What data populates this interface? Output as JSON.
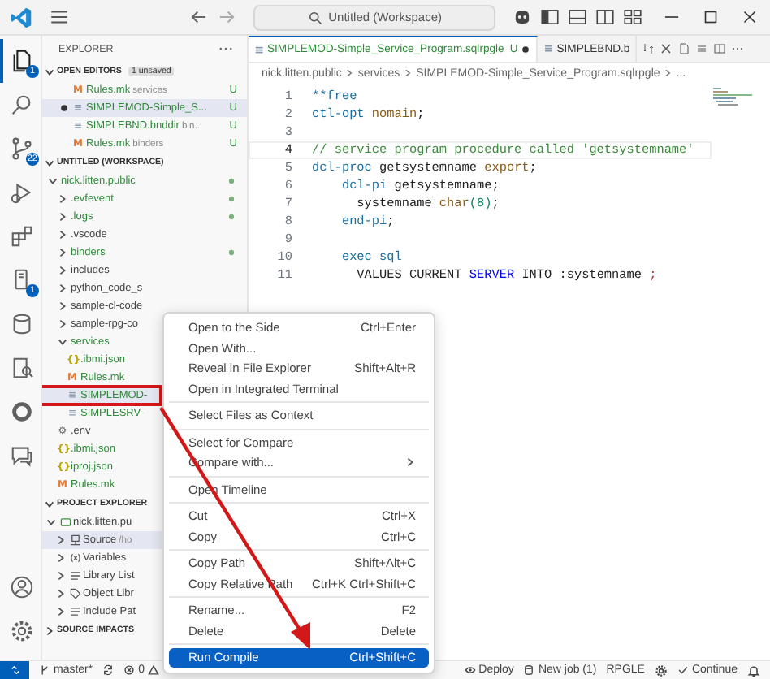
{
  "title_bar": {
    "search": "Untitled (Workspace)"
  },
  "activity_bar": {
    "items": [
      {
        "kind": "files",
        "badge": "1",
        "selected": true
      },
      {
        "kind": "search",
        "selected": false
      },
      {
        "kind": "source-control",
        "badge": "22",
        "selected": false
      },
      {
        "kind": "run",
        "selected": false
      },
      {
        "kind": "extensions",
        "selected": false
      },
      {
        "kind": "device",
        "badge": "1",
        "selected": false
      },
      {
        "kind": "database",
        "selected": false
      },
      {
        "kind": "search-doc",
        "selected": false
      },
      {
        "kind": "ring",
        "selected": false
      },
      {
        "kind": "chat",
        "selected": false
      }
    ],
    "bottom": [
      {
        "kind": "account"
      },
      {
        "kind": "settings"
      }
    ]
  },
  "sidebar": {
    "title": "EXPLORER",
    "open_editors": {
      "title": "OPEN EDITORS",
      "badge": "1 unsaved",
      "expanded": true,
      "items": [
        {
          "glyph": "M",
          "kind": "make",
          "name": "Rules.mk",
          "description": "services",
          "status": "U",
          "dirty": false,
          "selected": false
        },
        {
          "glyph": "≡",
          "kind": "source",
          "name": "SIMPLEMOD-Simple_S...",
          "status": "U",
          "dirty": true,
          "selected": true
        },
        {
          "glyph": "≡",
          "kind": "source",
          "name": "SIMPLEBND.bnddir",
          "description": "bin...",
          "status": "U",
          "dirty": false,
          "selected": false
        },
        {
          "glyph": "M",
          "kind": "make",
          "name": "Rules.mk",
          "description": "binders",
          "status": "U",
          "dirty": false,
          "selected": false
        }
      ]
    },
    "workspace": {
      "title": "UNTITLED (WORKSPACE)",
      "expanded": true,
      "items": [
        {
          "name": "nick.litten.public",
          "kind": "folder",
          "expanded": true,
          "untracked": true,
          "dot": true,
          "selected": false,
          "boxed": false,
          "children": [
            {
              "name": ".evfevent",
              "kind": "folder",
              "expanded": false,
              "untracked": true,
              "dot": true,
              "selected": false,
              "boxed": false
            },
            {
              "name": ".logs",
              "kind": "folder",
              "expanded": false,
              "untracked": true,
              "dot": true,
              "selected": false,
              "boxed": false
            },
            {
              "name": ".vscode",
              "kind": "folder",
              "expanded": false,
              "untracked": false,
              "dot": false,
              "selected": false,
              "boxed": false
            },
            {
              "name": "binders",
              "kind": "folder",
              "expanded": false,
              "untracked": true,
              "dot": true,
              "selected": false,
              "boxed": false
            },
            {
              "name": "includes",
              "kind": "folder",
              "expanded": false,
              "untracked": false,
              "dot": false,
              "selected": false,
              "boxed": false
            },
            {
              "name": "python_code_s",
              "kind": "folder",
              "expanded": false,
              "untracked": false,
              "dot": false,
              "selected": false,
              "boxed": false
            },
            {
              "name": "sample-cl-code",
              "kind": "folder",
              "expanded": false,
              "untracked": false,
              "dot": false,
              "selected": false,
              "boxed": false
            },
            {
              "name": "sample-rpg-co",
              "kind": "folder",
              "expanded": false,
              "untracked": false,
              "dot": false,
              "selected": false,
              "boxed": false
            },
            {
              "name": "services",
              "kind": "folder",
              "expanded": true,
              "untracked": true,
              "dot": false,
              "selected": false,
              "boxed": false,
              "children": [
                {
                  "name": ".ibmi.json",
                  "kind": "json",
                  "glyph": "{}",
                  "untracked": true,
                  "dot": false,
                  "selected": false,
                  "boxed": false
                },
                {
                  "name": "Rules.mk",
                  "kind": "make",
                  "glyph": "M",
                  "untracked": true,
                  "dot": false,
                  "selected": false,
                  "boxed": false
                },
                {
                  "name": "SIMPLEMOD-",
                  "kind": "source",
                  "glyph": "≡",
                  "untracked": true,
                  "dot": false,
                  "selected": true,
                  "boxed": true
                },
                {
                  "name": "SIMPLESRV-",
                  "kind": "source",
                  "glyph": "≡",
                  "untracked": true,
                  "dot": false,
                  "selected": false,
                  "boxed": false
                }
              ]
            },
            {
              "name": ".env",
              "kind": "env",
              "glyph": "⚙",
              "untracked": false,
              "dot": false,
              "selected": false,
              "boxed": false
            },
            {
              "name": ".ibmi.json",
              "kind": "json",
              "glyph": "{}",
              "untracked": true,
              "dot": false,
              "selected": false,
              "boxed": false
            },
            {
              "name": "iproj.json",
              "kind": "json",
              "glyph": "{}",
              "untracked": true,
              "dot": false,
              "selected": false,
              "boxed": false
            },
            {
              "name": "Rules.mk",
              "kind": "make",
              "glyph": "M",
              "untracked": true,
              "dot": false,
              "selected": false,
              "boxed": false
            }
          ]
        }
      ]
    },
    "project_explorer": {
      "title": "PROJECT EXPLORER",
      "expanded": true,
      "items": [
        {
          "name": "nick.litten.pu",
          "kind": "project",
          "expanded": true,
          "selected": false,
          "children": [
            {
              "name": "Source",
              "description": "/ho",
              "kind": "server",
              "expanded": false,
              "selected": true
            },
            {
              "name": "Variables",
              "kind": "variable",
              "expanded": false,
              "selected": false
            },
            {
              "name": "Library List",
              "kind": "list",
              "expanded": false,
              "selected": false
            },
            {
              "name": "Object Libr",
              "kind": "tag",
              "expanded": false,
              "selected": false
            },
            {
              "name": "Include Pat",
              "kind": "list",
              "expanded": false,
              "selected": false
            }
          ]
        }
      ]
    },
    "source_impacts": {
      "title": "SOURCE IMPACTS",
      "expanded": false
    }
  },
  "editor": {
    "tabs": [
      {
        "glyph": "≡",
        "name": "SIMPLEMOD-Simple_Service_Program.sqlrpgle",
        "status": "U",
        "dirty": true,
        "selected": true
      },
      {
        "glyph": "≡",
        "name": "SIMPLEBND.b",
        "dirty": false,
        "selected": false
      }
    ],
    "breadcrumb": [
      "nick.litten.public",
      "services",
      "SIMPLEMOD-Simple_Service_Program.sqlrpgle",
      "..."
    ],
    "lines": [
      {
        "number": "1",
        "current": false,
        "tokens": [
          {
            "text": "**free",
            "kind": "keyword"
          }
        ]
      },
      {
        "number": "2",
        "current": false,
        "tokens": [
          {
            "text": "ctl-opt",
            "kind": "keyword"
          },
          {
            "text": " nomain",
            "kind": "function"
          },
          {
            "text": ";",
            "kind": "identifier"
          }
        ]
      },
      {
        "number": "3",
        "current": false
      },
      {
        "number": "4",
        "current": true,
        "tokens": [
          {
            "text": "// service program procedure called 'getsystemname'",
            "kind": "comment"
          }
        ]
      },
      {
        "number": "5",
        "current": false,
        "tokens": [
          {
            "text": "dcl-proc",
            "kind": "keyword"
          },
          {
            "text": " getsystemname",
            "kind": "identifier"
          },
          {
            "text": " export",
            "kind": "function"
          },
          {
            "text": ";",
            "kind": "identifier"
          }
        ]
      },
      {
        "number": "6",
        "current": false,
        "tokens": [
          {
            "text": "    dcl-pi",
            "kind": "keyword"
          },
          {
            "text": " getsystemname",
            "kind": "identifier"
          },
          {
            "text": ";",
            "kind": "identifier"
          }
        ]
      },
      {
        "number": "7",
        "current": false,
        "tokens": [
          {
            "text": "      systemname",
            "kind": "identifier"
          },
          {
            "text": " char",
            "kind": "function"
          },
          {
            "text": "(8)",
            "kind": "number"
          },
          {
            "text": ";",
            "kind": "identifier"
          }
        ]
      },
      {
        "number": "8",
        "current": false,
        "tokens": [
          {
            "text": "    end-pi",
            "kind": "keyword"
          },
          {
            "text": ";",
            "kind": "identifier"
          }
        ]
      },
      {
        "number": "9",
        "current": false
      },
      {
        "number": "10",
        "current": false,
        "tokens": [
          {
            "text": "    exec sql",
            "kind": "keyword"
          }
        ]
      },
      {
        "number": "11",
        "current": false,
        "tokens": [
          {
            "text": "      VALUES CURRENT ",
            "kind": "identifier"
          },
          {
            "text": "SERVER",
            "kind": "sql"
          },
          {
            "text": " INTO :systemname ",
            "kind": "identifier"
          },
          {
            "text": ";",
            "kind": "punctuation"
          }
        ]
      }
    ]
  },
  "context_menu": [
    {
      "kind": "item",
      "label": "Open to the Side",
      "shortcut": "Ctrl+Enter",
      "submenu": false,
      "selected": false
    },
    {
      "kind": "item",
      "label": "Open With...",
      "submenu": false,
      "selected": false
    },
    {
      "kind": "item",
      "label": "Reveal in File Explorer",
      "shortcut": "Shift+Alt+R",
      "submenu": false,
      "selected": false
    },
    {
      "kind": "item",
      "label": "Open in Integrated Terminal",
      "submenu": false,
      "selected": false
    },
    {
      "kind": "separator"
    },
    {
      "kind": "item",
      "label": "Select Files as Context",
      "submenu": false,
      "selected": false
    },
    {
      "kind": "separator"
    },
    {
      "kind": "item",
      "label": "Select for Compare",
      "submenu": false,
      "selected": false
    },
    {
      "kind": "item",
      "label": "Compare with...",
      "submenu": true,
      "selected": false
    },
    {
      "kind": "separator"
    },
    {
      "kind": "item",
      "label": "Open Timeline",
      "submenu": false,
      "selected": false
    },
    {
      "kind": "separator"
    },
    {
      "kind": "item",
      "label": "Cut",
      "shortcut": "Ctrl+X",
      "submenu": false,
      "selected": false
    },
    {
      "kind": "item",
      "label": "Copy",
      "shortcut": "Ctrl+C",
      "submenu": false,
      "selected": false
    },
    {
      "kind": "separator"
    },
    {
      "kind": "item",
      "label": "Copy Path",
      "shortcut": "Shift+Alt+C",
      "submenu": false,
      "selected": false
    },
    {
      "kind": "item",
      "label": "Copy Relative Path",
      "shortcut": "Ctrl+K Ctrl+Shift+C",
      "submenu": false,
      "selected": false
    },
    {
      "kind": "separator"
    },
    {
      "kind": "item",
      "label": "Rename...",
      "shortcut": "F2",
      "submenu": false,
      "selected": false
    },
    {
      "kind": "item",
      "label": "Delete",
      "shortcut": "Delete",
      "submenu": false,
      "selected": false
    },
    {
      "kind": "separator"
    },
    {
      "kind": "item",
      "label": "Run Compile",
      "shortcut": "Ctrl+Shift+C",
      "submenu": false,
      "selected": true
    }
  ],
  "status_bar": {
    "left": [
      {
        "kind": "remote"
      },
      {
        "kind": "branch",
        "text": "master*"
      },
      {
        "kind": "sync"
      },
      {
        "kind": "problems",
        "text": "0"
      }
    ],
    "right": [
      {
        "kind": "deploy",
        "text": "Deploy"
      },
      {
        "kind": "job",
        "text": "New job (1)"
      },
      {
        "kind": "plain",
        "text": "RPGLE"
      },
      {
        "kind": "gear"
      },
      {
        "kind": "continue",
        "text": "Continue"
      },
      {
        "kind": "bell"
      }
    ]
  }
}
